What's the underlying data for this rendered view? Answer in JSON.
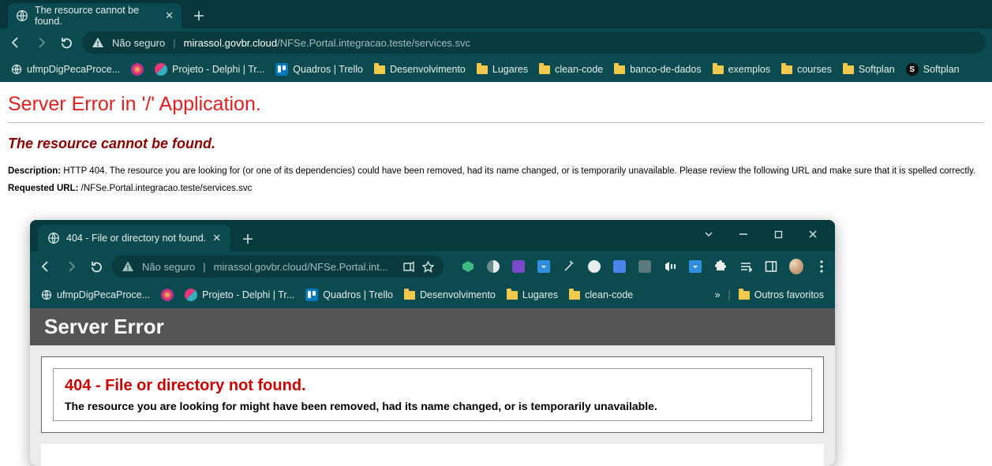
{
  "outer": {
    "tab_title": "The resource cannot be found.",
    "security_label": "Não seguro",
    "url_host": "mirassol.govbr.cloud",
    "url_path": "/NFSe.Portal.integracao.teste/services.svc",
    "bookmarks": [
      {
        "label": "ufmpDigPecaProce...",
        "type": "globe"
      },
      {
        "label": "",
        "type": "ig"
      },
      {
        "label": "Projeto - Delphi | Tr...",
        "type": "pt"
      },
      {
        "label": "Quadros | Trello",
        "type": "trello"
      },
      {
        "label": "Desenvolvimento",
        "type": "folder"
      },
      {
        "label": "Lugares",
        "type": "folder"
      },
      {
        "label": "clean-code",
        "type": "folder"
      },
      {
        "label": "banco-de-dados",
        "type": "folder"
      },
      {
        "label": "exemplos",
        "type": "folder"
      },
      {
        "label": "courses",
        "type": "folder"
      },
      {
        "label": "Softplan",
        "type": "folder"
      },
      {
        "label": "Softplan",
        "type": "sp"
      }
    ]
  },
  "error_outer": {
    "header": "Server Error in '/' Application.",
    "subheader": "The resource cannot be found.",
    "desc_label": "Description:",
    "desc_text": "HTTP 404. The resource you are looking for (or one of its dependencies) could have been removed, had its name changed, or is temporarily unavailable.  Please review the following URL and make sure that it is spelled correctly.",
    "req_label": "Requested URL:",
    "req_value": "/NFSe.Portal.integracao.teste/services.svc"
  },
  "inner": {
    "tab_title": "404 - File or directory not found.",
    "security_label": "Não seguro",
    "url_host": "mirassol.govbr.cloud",
    "url_path": "/NFSe.Portal.int...",
    "bookmarks": [
      {
        "label": "ufmpDigPecaProce...",
        "type": "globe"
      },
      {
        "label": "",
        "type": "ig"
      },
      {
        "label": "Projeto - Delphi | Tr...",
        "type": "pt"
      },
      {
        "label": "Quadros | Trello",
        "type": "trello"
      },
      {
        "label": "Desenvolvimento",
        "type": "folder"
      },
      {
        "label": "Lugares",
        "type": "folder"
      },
      {
        "label": "clean-code",
        "type": "folder"
      }
    ],
    "overflow": "»",
    "other_fav": "Outros favoritos"
  },
  "error_inner": {
    "header": "Server Error",
    "h2": "404 - File or directory not found.",
    "h3": "The resource you are looking for might have been removed, had its name changed, or is temporarily unavailable."
  }
}
